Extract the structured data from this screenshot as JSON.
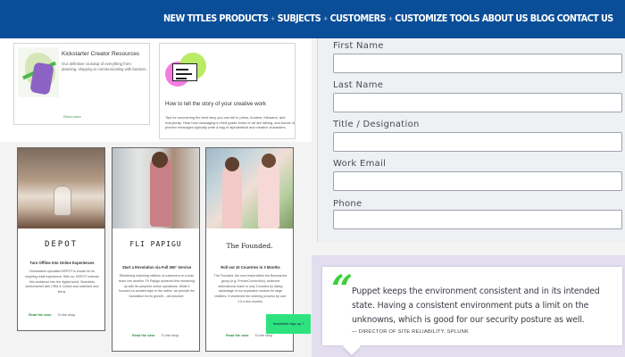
{
  "nav": {
    "items": [
      "NEW TITLES",
      "PRODUCTS",
      "SUBJECTS",
      "CUSTOMERS",
      "CUSTOMIZE TOOLS",
      "ABOUT US",
      "BLOG",
      "CONTACT US"
    ],
    "separator": "+"
  },
  "resources": [
    {
      "title": "Kickstarter Creator Resources",
      "description": "Our definitive roundup of everything from planning, shipping to communicating with backers.",
      "link": "Read more"
    },
    {
      "title": "How to tell the story of your creative work",
      "description": "Tips for uncovering the best story you can tell to press, funders, followers, and everybody. Hear how messaging in third-grade forms of art are talking, and bonds of pioneer messages typically write a bag of alphabetical and creative characters.",
      "link": "Read more"
    }
  ],
  "products": [
    {
      "name": "DEPOT",
      "subtitle": "Turn Offline Into Online Experiences",
      "description": "Homewares specialist DEPOT is known for its inspiring retail experience. With us, DEPOT extends this ambience into the digital world. Seamless omnichannel with CRM & Collect and unlimited new items.",
      "primary_link": "Read the case",
      "secondary_link": "To the shop"
    },
    {
      "name": "FLI PAPIGU",
      "subtitle": "Start a Revolution via Full 360° Service",
      "description": "Effortlessly matching millions of customers on a lean team one another. Fli Papigu achieved this remaining up with its complete online operations. While it focused on curated style in the online, we provide the foundation for its growth – all-inclusive.",
      "primary_link": "Read the case",
      "secondary_link": "To the shop"
    },
    {
      "name": "The Founded.",
      "subtitle": "Roll out 10 Countries in 3 Months",
      "description": "The Founded, the new brand within the Bonmarche group (e.g. FrenchConnection), achieved international reach in only 3 months by taking advantage of our expansion module for large retailers. It shortened the ordering process by over 1.5 a few months.",
      "primary_link": "Read the case",
      "secondary_link": "To the shop"
    }
  ],
  "newsletter": {
    "label": "Newsletter sign up ?"
  },
  "form": {
    "fields": [
      {
        "label": "First Name",
        "value": ""
      },
      {
        "label": "Last Name",
        "value": ""
      },
      {
        "label": "Title / Designation",
        "value": ""
      },
      {
        "label": "Work Email",
        "value": ""
      },
      {
        "label": "Phone",
        "value": ""
      }
    ]
  },
  "testimonial": {
    "quote_mark": "“",
    "text": "Puppet keeps the environment consistent and in its intended state. Having a consistent environment puts a limit on the unknowns, which is good for our security posture as well.",
    "attribution": "— DIRECTOR OF SITE RELIABILITY, SPLUNK",
    "accent_color": "#3ad13a"
  },
  "colors": {
    "nav_background": "#0b4e98",
    "testimonial_background": "#e3ddf0",
    "newsletter_button": "#2ee37d"
  }
}
